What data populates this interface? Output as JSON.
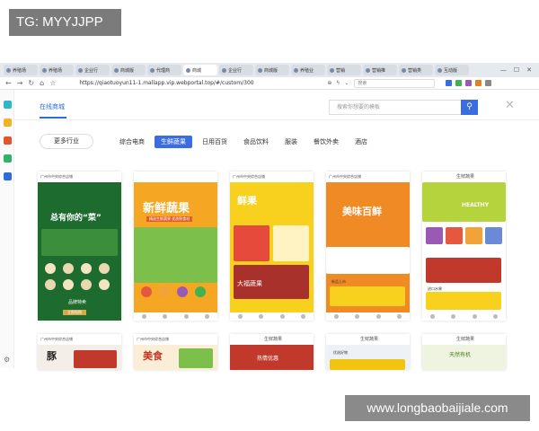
{
  "watermarks": {
    "top_left": "TG: MYYJJPP",
    "bottom_right": "www.longbaobaijiale.com"
  },
  "browser": {
    "tabs": [
      "养殖场",
      "养殖场",
      "企业行",
      "商城版",
      "代理商",
      "商城",
      "企业行",
      "商城版",
      "养殖业",
      "营销",
      "营销推",
      "营销类",
      "互动版"
    ],
    "url": "https://qiaotuoyun11-1.mallapp.vip.webportal.top/#/custom/300",
    "search_placeholder": "搜索"
  },
  "page": {
    "store_title": "在线商城",
    "search_placeholder": "搜索你想要的模板",
    "close": "✕",
    "more_industries": "更多行业",
    "categories": [
      "综合电商",
      "生鲜蔬果",
      "日用百货",
      "食品饮料",
      "服装",
      "餐饮外卖",
      "酒店"
    ],
    "active_category": "生鲜蔬果"
  },
  "templates": [
    {
      "header": "广州市中央综合店铺",
      "headline": "总有你的“菜”",
      "footer": "品牌特卖",
      "button": "立即抢购"
    },
    {
      "header": "",
      "headline": "新鲜蔬果",
      "tagline": "精选生鲜蔬果 优质鲜食材"
    },
    {
      "header": "广州市中央综合店铺",
      "headline": "鲜果",
      "sub": "大福蔬果"
    },
    {
      "header": "广州市中央综合店铺",
      "headline": "美味百鲜",
      "sub": "新品上市"
    },
    {
      "header": "生鲜蔬果",
      "headline": "HEALTHY",
      "sub": "进口水果"
    },
    {
      "header": "广州市中央综合店铺",
      "headline": "豚"
    },
    {
      "header": "广州市中央综合店铺",
      "headline": "美食"
    },
    {
      "header": "生鲜蔬果",
      "headline": "热情优惠"
    },
    {
      "header": "生鲜蔬果",
      "headline": "优选好物"
    },
    {
      "header": "生鲜蔬果",
      "headline": "天然有机"
    }
  ]
}
